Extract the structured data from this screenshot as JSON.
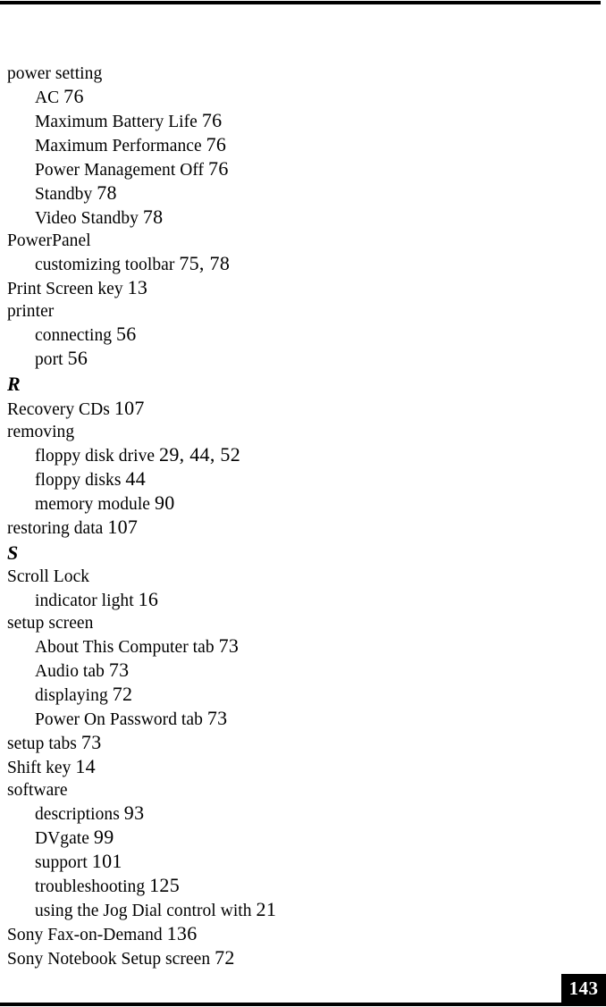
{
  "page": {
    "number": "143",
    "kind": "index"
  },
  "entries": [
    {
      "type": "main",
      "term": "power setting",
      "pages": ""
    },
    {
      "type": "sub",
      "term": "AC",
      "pages": "76"
    },
    {
      "type": "sub",
      "term": "Maximum Battery Life",
      "pages": "76"
    },
    {
      "type": "sub",
      "term": "Maximum Performance",
      "pages": "76"
    },
    {
      "type": "sub",
      "term": "Power Management Off",
      "pages": "76"
    },
    {
      "type": "sub",
      "term": "Standby",
      "pages": "78"
    },
    {
      "type": "sub",
      "term": "Video Standby",
      "pages": "78"
    },
    {
      "type": "main",
      "term": "PowerPanel",
      "pages": ""
    },
    {
      "type": "sub",
      "term": "customizing toolbar",
      "pages": "75, 78"
    },
    {
      "type": "main",
      "term": "Print Screen key",
      "pages": "13"
    },
    {
      "type": "main",
      "term": "printer",
      "pages": ""
    },
    {
      "type": "sub",
      "term": "connecting",
      "pages": "56"
    },
    {
      "type": "sub",
      "term": "port",
      "pages": "56"
    },
    {
      "type": "section",
      "term": "R",
      "pages": ""
    },
    {
      "type": "main",
      "term": "Recovery CDs",
      "pages": "107"
    },
    {
      "type": "main",
      "term": "removing",
      "pages": ""
    },
    {
      "type": "sub",
      "term": "floppy disk drive",
      "pages": "29, 44, 52"
    },
    {
      "type": "sub",
      "term": "floppy disks",
      "pages": "44"
    },
    {
      "type": "sub",
      "term": "memory module",
      "pages": "90"
    },
    {
      "type": "main",
      "term": "restoring data",
      "pages": "107"
    },
    {
      "type": "section",
      "term": "S",
      "pages": ""
    },
    {
      "type": "main",
      "term": "Scroll Lock",
      "pages": ""
    },
    {
      "type": "sub",
      "term": "indicator light",
      "pages": "16"
    },
    {
      "type": "main",
      "term": "setup screen",
      "pages": ""
    },
    {
      "type": "sub",
      "term": "About This Computer tab",
      "pages": "73"
    },
    {
      "type": "sub",
      "term": "Audio tab",
      "pages": "73"
    },
    {
      "type": "sub",
      "term": "displaying",
      "pages": "72"
    },
    {
      "type": "sub",
      "term": "Power On Password tab",
      "pages": "73"
    },
    {
      "type": "main",
      "term": "setup tabs",
      "pages": "73"
    },
    {
      "type": "main",
      "term": "Shift key",
      "pages": "14"
    },
    {
      "type": "main",
      "term": "software",
      "pages": ""
    },
    {
      "type": "sub",
      "term": "descriptions",
      "pages": "93"
    },
    {
      "type": "sub",
      "term": "DVgate",
      "pages": "99"
    },
    {
      "type": "sub",
      "term": "support",
      "pages": "101"
    },
    {
      "type": "sub",
      "term": "troubleshooting",
      "pages": "125"
    },
    {
      "type": "sub",
      "term": "using the Jog Dial control with",
      "pages": "21"
    },
    {
      "type": "main",
      "term": "Sony Fax-on-Demand",
      "pages": "136"
    },
    {
      "type": "main",
      "term": "Sony Notebook Setup screen",
      "pages": "72"
    }
  ]
}
